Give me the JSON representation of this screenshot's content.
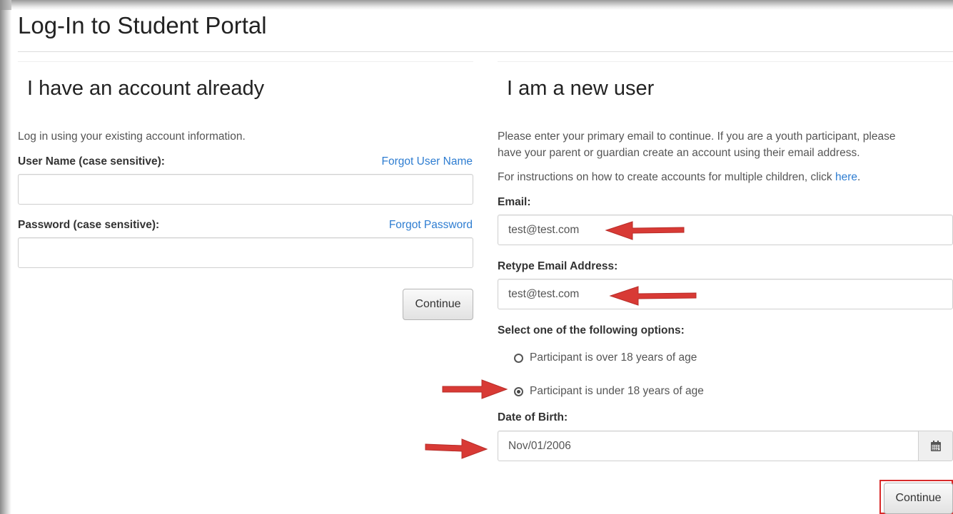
{
  "page": {
    "title": "Log-In to Student Portal"
  },
  "existing": {
    "heading": "I have an account already",
    "intro": "Log in using your existing account information.",
    "username_label": "User Name (case sensitive):",
    "forgot_username": "Forgot User Name",
    "username_value": "",
    "password_label": "Password (case sensitive):",
    "forgot_password": "Forgot Password",
    "password_value": "",
    "continue_label": "Continue"
  },
  "new_user": {
    "heading": "I am a new user",
    "intro_line1": "Please enter your primary email to continue. If you are a youth participant, please",
    "intro_line2": "have your parent or guardian create an account using their email address.",
    "instructions_text": "For instructions on how to create accounts for multiple children, click ",
    "instructions_link": "here",
    "instructions_end": ".",
    "email_label": "Email:",
    "email_value": "test@test.com",
    "retype_label": "Retype Email Address:",
    "retype_value": "test@test.com",
    "options_label": "Select one of the following options:",
    "option_over": "Participant is over 18 years of age",
    "option_under": "Participant is under 18 years of age",
    "selected_option": "under",
    "dob_label": "Date of Birth:",
    "dob_value": "Nov/01/2006",
    "continue_label": "Continue"
  },
  "annotation": {
    "arrow_color": "#d83a35",
    "highlight_color": "#d82a2a"
  },
  "icons": {
    "calendar": "calendar-icon",
    "arrows": "red-arrow-icon"
  }
}
